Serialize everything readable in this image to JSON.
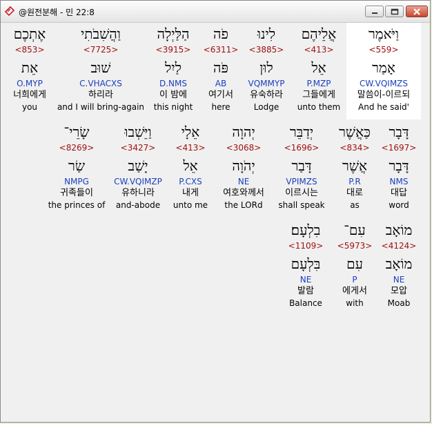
{
  "window": {
    "title": "@원전분해 - 민 22:8"
  },
  "rows": [
    [
      {
        "hebrew": "וַיֹּאמֶר",
        "strong": "<559>",
        "lexeme": "אָמַר",
        "morph": "CW.VQIMZS",
        "korean": "말씀이-이르되",
        "english": "And he said'"
      },
      {
        "hebrew": "אֲלֵיהֶם",
        "strong": "<413>",
        "lexeme": "אֵל",
        "morph": "P.MZP",
        "korean": "그들에게",
        "english": "unto them"
      },
      {
        "hebrew": "לִינוּ",
        "strong": "<3885>",
        "lexeme": "לוּן",
        "morph": "VQMMYP",
        "korean": "유숙하라",
        "english": "Lodge"
      },
      {
        "hebrew": "פֹה",
        "strong": "<6311>",
        "lexeme": "פֹּה",
        "morph": "AB",
        "korean": "여기서",
        "english": "here"
      },
      {
        "hebrew": "הַלַּיְלָה",
        "strong": "<3915>",
        "lexeme": "לַיִל",
        "morph": "D.NMS",
        "korean": "이 밤에",
        "english": "this night"
      },
      {
        "hebrew": "וַהֲשִׁבֹתִי",
        "strong": "<7725>",
        "lexeme": "שׁוּב",
        "morph": "C.VHACXS",
        "korean": "하리라",
        "english": "and I will bring-again"
      },
      {
        "hebrew": "אֶתְכֶם",
        "strong": "<853>",
        "lexeme": "אֵת",
        "morph": "O.MYP",
        "korean": "너희에게",
        "english": "you"
      }
    ],
    [
      {
        "hebrew": "דָּבָר",
        "strong": "<1697>",
        "lexeme": "דָּבָר",
        "morph": "NMS",
        "korean": "대답",
        "english": "word"
      },
      {
        "hebrew": "כַּאֲשֶׁר",
        "strong": "<834>",
        "lexeme": "אֲשֶׁר",
        "morph": "P.R",
        "korean": "대로",
        "english": "as"
      },
      {
        "hebrew": "יְדַבֵּר",
        "strong": "<1696>",
        "lexeme": "דָּבַר",
        "morph": "VPIMZS",
        "korean": "이르시는",
        "english": "shall speak"
      },
      {
        "hebrew": "יְהוָה",
        "strong": "<3068>",
        "lexeme": "יְהֹוָה",
        "morph": "NE",
        "korean": "여호와께서",
        "english": "the LORd"
      },
      {
        "hebrew": "אֵלָי",
        "strong": "<413>",
        "lexeme": "אֵל",
        "morph": "P.CXS",
        "korean": "내게",
        "english": "unto me"
      },
      {
        "hebrew": "וַיֵּשְׁבוּ",
        "strong": "<3427>",
        "lexeme": "יָשַׁב",
        "morph": "CW.VQIMZP",
        "korean": "유하니라",
        "english": "and-abode"
      },
      {
        "hebrew": "שָׂרֵי־",
        "strong": "<8269>",
        "lexeme": "שַׂר",
        "morph": "NMPG",
        "korean": "귀족들이",
        "english": "the princes of"
      }
    ],
    [
      {
        "hebrew": "מוֹאָב",
        "strong": "<4124>",
        "lexeme": "מוֹאָב",
        "morph": "NE",
        "korean": "모압",
        "english": "Moab"
      },
      {
        "hebrew": "עִם־",
        "strong": "<5973>",
        "lexeme": "עִם",
        "morph": "P",
        "korean": "에게서",
        "english": "with"
      },
      {
        "hebrew": "בִלְעָם׃",
        "strong": "<1109>",
        "lexeme": "בִּלְעָם",
        "morph": "NE",
        "korean": "발람",
        "english": "Balance"
      }
    ]
  ]
}
